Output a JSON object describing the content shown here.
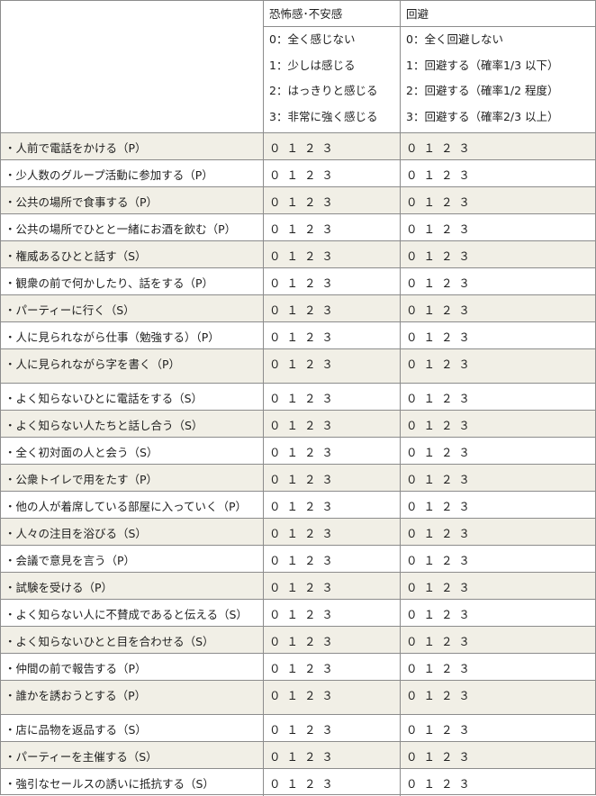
{
  "header": {
    "fear_title": "恐怖感･不安感",
    "fear_scale": [
      "0：全く感じない",
      "1：少しは感じる",
      "2：はっきりと感じる",
      "3：非常に強く感じる"
    ],
    "avoid_title": "回避",
    "avoid_scale": [
      "0：全く回避しない",
      "1：回避する（確率1/3 以下）",
      "2：回避する（確率1/2 程度）",
      "3：回避する（確率2/3 以上）"
    ]
  },
  "choices": "０ １ ２ ３",
  "items": [
    "・人前で電話をかける（P）",
    "・少人数のグループ活動に参加する（P）",
    "・公共の場所で食事する（P）",
    "・公共の場所でひとと一緒にお酒を飲む（P）",
    "・権威あるひとと話す（S）",
    "・観衆の前で何かしたり、話をする（P）",
    "・パーティーに行く（S）",
    "・人に見られながら仕事（勉強する）（P）",
    "・人に見られながら字を書く（P）",
    "・よく知らないひとに電話をする（S）",
    "・よく知らない人たちと話し合う（S）",
    "・全く初対面の人と会う（S）",
    "・公衆トイレで用をたす（P）",
    "・他の人が着席している部屋に入っていく（P）",
    "・人々の注目を浴びる（S）",
    "・会議で意見を言う（P）",
    "・試験を受ける（P）",
    "・よく知らない人に不賛成であると伝える（S）",
    "・よく知らないひとと目を合わせる（S）",
    "・仲間の前で報告する（P）",
    "・誰かを誘おうとする（P）",
    "・店に品物を返品する（S）",
    "・パーティーを主催する（S）",
    "・強引なセールスの誘いに抵抗する（S）"
  ]
}
